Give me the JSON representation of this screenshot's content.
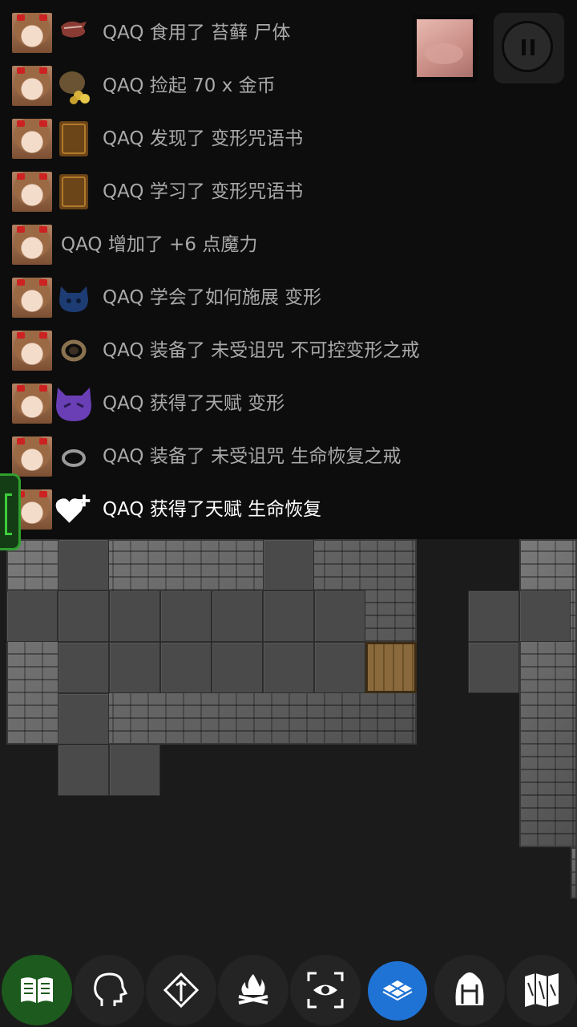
{
  "log": {
    "entries": [
      {
        "text": "QAQ 食用了 苔藓 尸体",
        "icon": "meat-corpse-icon"
      },
      {
        "text": "QAQ 捡起 70 x 金币",
        "icon": "gold-coins-icon"
      },
      {
        "text": "QAQ 发现了 变形咒语书",
        "icon": "spellbook-icon"
      },
      {
        "text": "QAQ 学习了 变形咒语书",
        "icon": "spellbook-icon"
      },
      {
        "text": "QAQ 增加了 +6 点魔力",
        "icon": ""
      },
      {
        "text": "QAQ 学会了如何施展 变形",
        "icon": "blue-cat-spell-icon"
      },
      {
        "text": "QAQ 装备了 未受诅咒 不可控变形之戒",
        "icon": "bronze-ring-icon"
      },
      {
        "text": "QAQ 获得了天赋 变形",
        "icon": "purple-cat-talent-icon"
      },
      {
        "text": "QAQ 装备了 未受诅咒 生命恢复之戒",
        "icon": "silver-ring-icon"
      },
      {
        "text": "QAQ 获得了天赋 生命恢复",
        "icon": "heart-plus-icon"
      }
    ]
  },
  "toolbar": {
    "buttons": [
      {
        "name": "journal-button",
        "icon": "book-icon"
      },
      {
        "name": "character-button",
        "icon": "head-profile-icon"
      },
      {
        "name": "skills-button",
        "icon": "diamond-staff-icon"
      },
      {
        "name": "rest-button",
        "icon": "campfire-icon"
      },
      {
        "name": "look-button",
        "icon": "eye-focus-icon"
      },
      {
        "name": "tiles-button",
        "icon": "tiles-icon"
      },
      {
        "name": "inventory-button",
        "icon": "backpack-icon"
      },
      {
        "name": "map-button",
        "icon": "folded-map-icon"
      }
    ]
  },
  "colors": {
    "log_background": "#0d0d0d",
    "log_text": "#a9a9a9",
    "log_text_latest": "#ffffff",
    "active_green": "#1d5a1d",
    "active_blue": "#1f73d4"
  }
}
